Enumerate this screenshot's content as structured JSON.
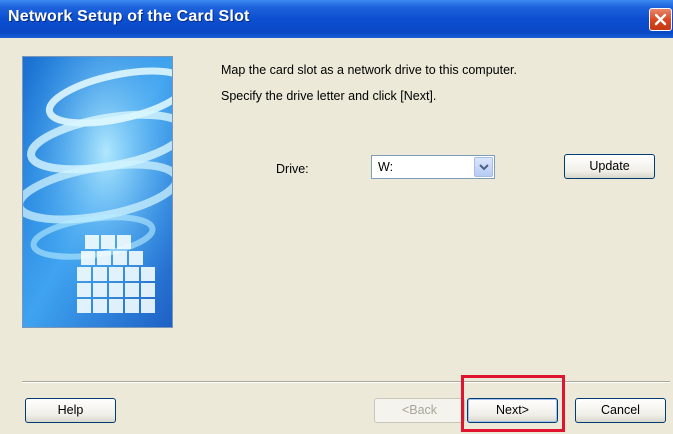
{
  "window": {
    "title": "Network Setup of the Card Slot"
  },
  "content": {
    "instruction_line1": "Map the card slot as a network drive to this computer.",
    "instruction_line2": "Specify the drive letter and click [Next].",
    "drive_label": "Drive:",
    "drive_value": "W:",
    "update_label": "Update"
  },
  "footer": {
    "help_label": "Help",
    "back_label": "<Back",
    "next_label": "Next>",
    "cancel_label": "Cancel"
  },
  "colors": {
    "titlebar": "#0b4fd1",
    "dialog_bg": "#ece9d8",
    "highlight": "#e0142e"
  },
  "icons": [
    "close-icon",
    "chevron-down-icon"
  ]
}
